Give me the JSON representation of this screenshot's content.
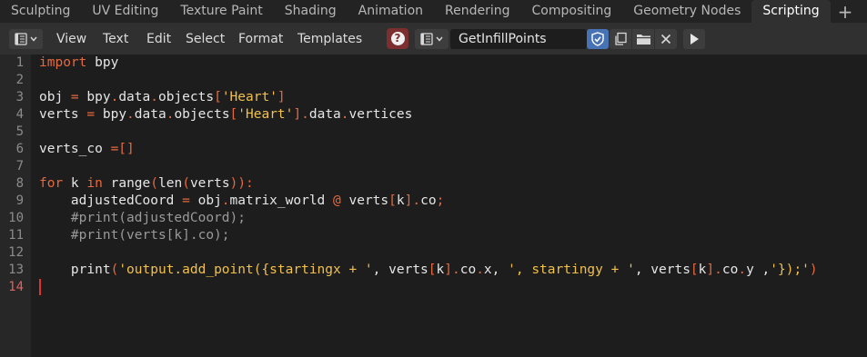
{
  "workspace_tabs": [
    "Sculpting",
    "UV Editing",
    "Texture Paint",
    "Shading",
    "Animation",
    "Rendering",
    "Compositing",
    "Geometry Nodes",
    "Scripting"
  ],
  "active_tab": "Scripting",
  "add_tab_label": "+",
  "menu": {
    "view": "View",
    "text": "Text",
    "edit": "Edit",
    "select": "Select",
    "format": "Format",
    "templates": "Templates"
  },
  "text_datablock": {
    "name": "GetInfillPoints"
  },
  "icons": {
    "editor_type": "text-editor-icon",
    "help": "question-icon",
    "browse": "text-browse-icon",
    "fake_user": "shield-check-icon",
    "new": "duplicate-icon",
    "open": "folder-icon",
    "unlink": "close-icon",
    "run": "play-icon"
  },
  "colors": {
    "keyword": "#e8683e",
    "string": "#f2c04c",
    "comment": "#9a9a9a",
    "active_line_number": "#e06060",
    "fake_user": "#4772b3",
    "help": "#7d2f2f"
  },
  "code": {
    "current_line": 14,
    "lines": [
      {
        "n": "1",
        "tokens": [
          {
            "t": "import",
            "c": "kw"
          },
          {
            "t": " bpy",
            "c": ""
          }
        ]
      },
      {
        "n": "2",
        "tokens": []
      },
      {
        "n": "3",
        "tokens": [
          {
            "t": "obj ",
            "c": ""
          },
          {
            "t": "=",
            "c": "kw"
          },
          {
            "t": " bpy",
            "c": ""
          },
          {
            "t": ".",
            "c": "kw"
          },
          {
            "t": "data",
            "c": ""
          },
          {
            "t": ".",
            "c": "kw"
          },
          {
            "t": "objects",
            "c": ""
          },
          {
            "t": "[",
            "c": "kw"
          },
          {
            "t": "'Heart'",
            "c": "str"
          },
          {
            "t": "]",
            "c": "kw"
          }
        ]
      },
      {
        "n": "4",
        "tokens": [
          {
            "t": "verts ",
            "c": ""
          },
          {
            "t": "=",
            "c": "kw"
          },
          {
            "t": " bpy",
            "c": ""
          },
          {
            "t": ".",
            "c": "kw"
          },
          {
            "t": "data",
            "c": ""
          },
          {
            "t": ".",
            "c": "kw"
          },
          {
            "t": "objects",
            "c": ""
          },
          {
            "t": "[",
            "c": "kw"
          },
          {
            "t": "'Heart'",
            "c": "str"
          },
          {
            "t": "]",
            "c": "kw"
          },
          {
            "t": ".",
            "c": "kw"
          },
          {
            "t": "data",
            "c": ""
          },
          {
            "t": ".",
            "c": "kw"
          },
          {
            "t": "vertices",
            "c": ""
          }
        ]
      },
      {
        "n": "5",
        "tokens": []
      },
      {
        "n": "6",
        "tokens": [
          {
            "t": "verts_co ",
            "c": ""
          },
          {
            "t": "=[]",
            "c": "kw"
          }
        ]
      },
      {
        "n": "7",
        "tokens": []
      },
      {
        "n": "8",
        "tokens": [
          {
            "t": "for",
            "c": "kw"
          },
          {
            "t": " k ",
            "c": ""
          },
          {
            "t": "in",
            "c": "kw"
          },
          {
            "t": " range",
            "c": ""
          },
          {
            "t": "(",
            "c": "kw"
          },
          {
            "t": "len",
            "c": ""
          },
          {
            "t": "(",
            "c": "kw"
          },
          {
            "t": "verts",
            "c": ""
          },
          {
            "t": ")):",
            "c": "kw"
          }
        ]
      },
      {
        "n": "9",
        "tokens": [
          {
            "t": "    adjustedCoord ",
            "c": ""
          },
          {
            "t": "=",
            "c": "kw"
          },
          {
            "t": " obj",
            "c": ""
          },
          {
            "t": ".",
            "c": "kw"
          },
          {
            "t": "matrix_world ",
            "c": ""
          },
          {
            "t": "@",
            "c": "kw"
          },
          {
            "t": " verts",
            "c": ""
          },
          {
            "t": "[",
            "c": "kw"
          },
          {
            "t": "k",
            "c": ""
          },
          {
            "t": "].",
            "c": "kw"
          },
          {
            "t": "co",
            "c": ""
          },
          {
            "t": ";",
            "c": "kw"
          }
        ]
      },
      {
        "n": "10",
        "tokens": [
          {
            "t": "    #print(adjustedCoord);",
            "c": "cmt"
          }
        ]
      },
      {
        "n": "11",
        "tokens": [
          {
            "t": "    #print(verts[k].co);",
            "c": "cmt"
          }
        ]
      },
      {
        "n": "12",
        "tokens": []
      },
      {
        "n": "13",
        "tokens": [
          {
            "t": "    print",
            "c": ""
          },
          {
            "t": "(",
            "c": "kw"
          },
          {
            "t": "'output.add_point({startingx + '",
            "c": "str"
          },
          {
            "t": ", verts",
            "c": ""
          },
          {
            "t": "[",
            "c": "kw"
          },
          {
            "t": "k",
            "c": ""
          },
          {
            "t": "].",
            "c": "kw"
          },
          {
            "t": "co",
            "c": ""
          },
          {
            "t": ".",
            "c": "kw"
          },
          {
            "t": "x, ",
            "c": ""
          },
          {
            "t": "', startingy + '",
            "c": "str"
          },
          {
            "t": ", verts",
            "c": ""
          },
          {
            "t": "[",
            "c": "kw"
          },
          {
            "t": "k",
            "c": ""
          },
          {
            "t": "].",
            "c": "kw"
          },
          {
            "t": "co",
            "c": ""
          },
          {
            "t": ".",
            "c": "kw"
          },
          {
            "t": "y ,",
            "c": ""
          },
          {
            "t": "'});'",
            "c": "str"
          },
          {
            "t": ")",
            "c": "kw"
          }
        ]
      },
      {
        "n": "14",
        "tokens": []
      }
    ]
  }
}
